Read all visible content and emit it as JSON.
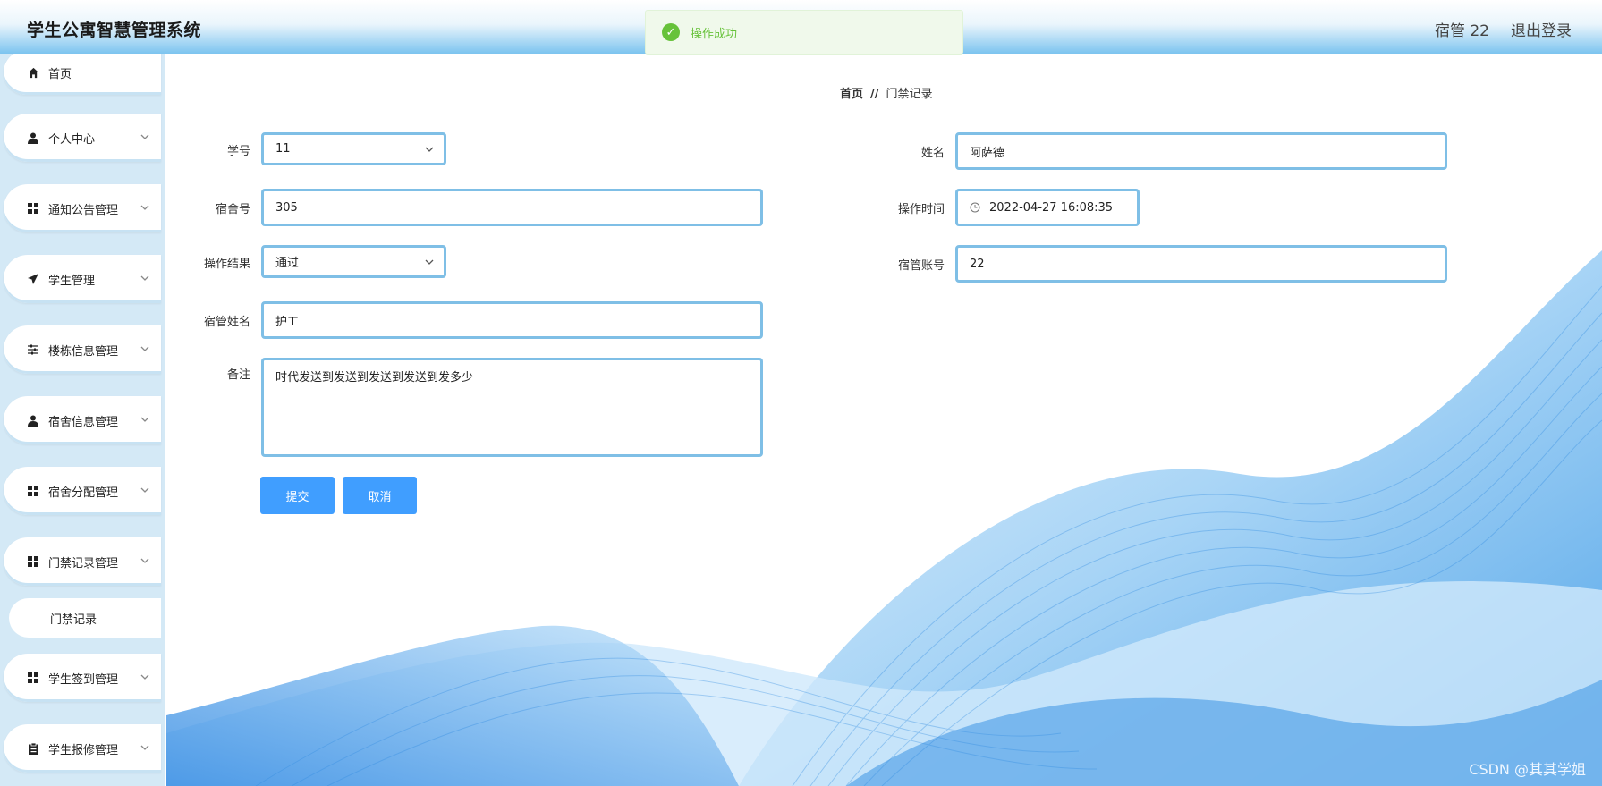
{
  "header": {
    "app_title": "学生公寓智慧管理系统",
    "user_label": "宿管 22",
    "logout_label": "退出登录"
  },
  "toast": {
    "message": "操作成功"
  },
  "sidebar": {
    "items": [
      {
        "label": "首页",
        "icon": "home-icon"
      },
      {
        "label": "个人中心",
        "icon": "user-icon"
      },
      {
        "label": "通知公告管理",
        "icon": "grid-icon"
      },
      {
        "label": "学生管理",
        "icon": "send-icon"
      },
      {
        "label": "楼栋信息管理",
        "icon": "sliders-icon"
      },
      {
        "label": "宿舍信息管理",
        "icon": "user-icon"
      },
      {
        "label": "宿舍分配管理",
        "icon": "grid-icon"
      },
      {
        "label": "门禁记录管理",
        "icon": "grid-icon"
      },
      {
        "label": "学生签到管理",
        "icon": "grid-icon"
      },
      {
        "label": "学生报修管理",
        "icon": "clipboard-icon"
      }
    ],
    "sub_item": "门禁记录"
  },
  "breadcrumb": {
    "home": "首页",
    "separator": "//",
    "current": "门禁记录"
  },
  "form": {
    "student_id": {
      "label": "学号",
      "value": "11"
    },
    "name": {
      "label": "姓名",
      "value": "阿萨德"
    },
    "dorm_no": {
      "label": "宿舍号",
      "value": "305"
    },
    "op_time": {
      "label": "操作时间",
      "value": "2022-04-27 16:08:35"
    },
    "op_result": {
      "label": "操作结果",
      "value": "通过"
    },
    "manager_account": {
      "label": "宿管账号",
      "value": "22"
    },
    "manager_name": {
      "label": "宿管姓名",
      "value": "护工"
    },
    "remark": {
      "label": "备注",
      "value": "时代发送到发送到发送到发送到发多少"
    },
    "submit_label": "提交",
    "cancel_label": "取消"
  },
  "watermark": "CSDN @其其学姐",
  "colors": {
    "primary": "#409eff",
    "field_border": "#7fbfe6",
    "success": "#67c23a",
    "sidebar_bg": "#d4e9f6"
  }
}
